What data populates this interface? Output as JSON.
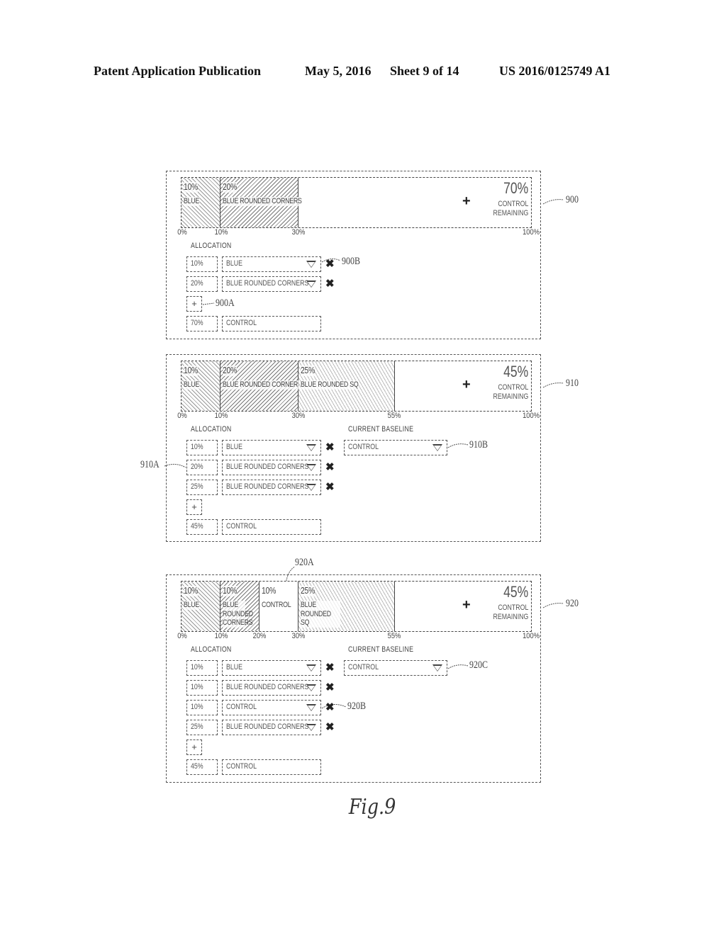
{
  "header": {
    "publication": "Patent Application Publication",
    "date": "May 5, 2016",
    "sheet": "Sheet 9 of 14",
    "number": "US 2016/0125749 A1"
  },
  "figure_label": "Fig.9",
  "panels": [
    {
      "ref": "900",
      "segments": [
        {
          "pct": "10%",
          "name": "BLUE",
          "value": 10
        },
        {
          "pct": "20%",
          "name": "BLUE ROUNDED CORNERS",
          "value": 20
        }
      ],
      "remaining": {
        "pct": "70%",
        "line1": "CONTROL",
        "line2": "REMAINING"
      },
      "ticks": [
        "0%",
        "10%",
        "30%",
        "100%"
      ],
      "allocation_label": "ALLOCATION",
      "rows": [
        {
          "pct": "10%",
          "variant": "BLUE"
        },
        {
          "pct": "20%",
          "variant": "BLUE ROUNDED CORNERS"
        }
      ],
      "add_label": "+",
      "control_row": {
        "pct": "70%",
        "variant": "CONTROL"
      },
      "refs": {
        "add": "900A",
        "remove": "900B"
      }
    },
    {
      "ref": "910",
      "segments": [
        {
          "pct": "10%",
          "name": "BLUE",
          "value": 10
        },
        {
          "pct": "20%",
          "name": "BLUE ROUNDED CORNERS",
          "value": 20
        },
        {
          "pct": "25%",
          "name": "BLUE ROUNDED SQ",
          "value": 25
        }
      ],
      "remaining": {
        "pct": "45%",
        "line1": "CONTROL",
        "line2": "REMAINING"
      },
      "ticks": [
        "0%",
        "10%",
        "30%",
        "55%",
        "100%"
      ],
      "allocation_label": "ALLOCATION",
      "baseline_label": "CURRENT BASELINE",
      "baseline_value": "CONTROL",
      "rows": [
        {
          "pct": "10%",
          "variant": "BLUE"
        },
        {
          "pct": "20%",
          "variant": "BLUE ROUNDED CORNERS"
        },
        {
          "pct": "25%",
          "variant": "BLUE ROUNDED CORNERS"
        }
      ],
      "add_label": "+",
      "control_row": {
        "pct": "45%",
        "variant": "CONTROL"
      },
      "refs": {
        "pct_field": "910A",
        "baseline": "910B"
      }
    },
    {
      "ref": "920",
      "segments": [
        {
          "pct": "10%",
          "name": "BLUE",
          "value": 10
        },
        {
          "pct": "10%",
          "name": "BLUE ROUNDED CORNERS",
          "value": 10
        },
        {
          "pct": "10%",
          "name": "CONTROL",
          "value": 10
        },
        {
          "pct": "25%",
          "name": "BLUE ROUNDED SQ",
          "value": 25
        }
      ],
      "remaining": {
        "pct": "45%",
        "line1": "CONTROL",
        "line2": "REMAINING"
      },
      "ticks": [
        "0%",
        "10%",
        "20%",
        "30%",
        "55%",
        "100%"
      ],
      "allocation_label": "ALLOCATION",
      "baseline_label": "CURRENT BASELINE",
      "baseline_value": "CONTROL",
      "rows": [
        {
          "pct": "10%",
          "variant": "BLUE"
        },
        {
          "pct": "10%",
          "variant": "BLUE ROUNDED CORNERS"
        },
        {
          "pct": "10%",
          "variant": "CONTROL"
        },
        {
          "pct": "25%",
          "variant": "BLUE ROUNDED CORNERS"
        }
      ],
      "add_label": "+",
      "control_row": {
        "pct": "45%",
        "variant": "CONTROL"
      },
      "refs": {
        "control_segment": "920A",
        "control_row_remove": "920B",
        "baseline": "920C"
      }
    }
  ]
}
